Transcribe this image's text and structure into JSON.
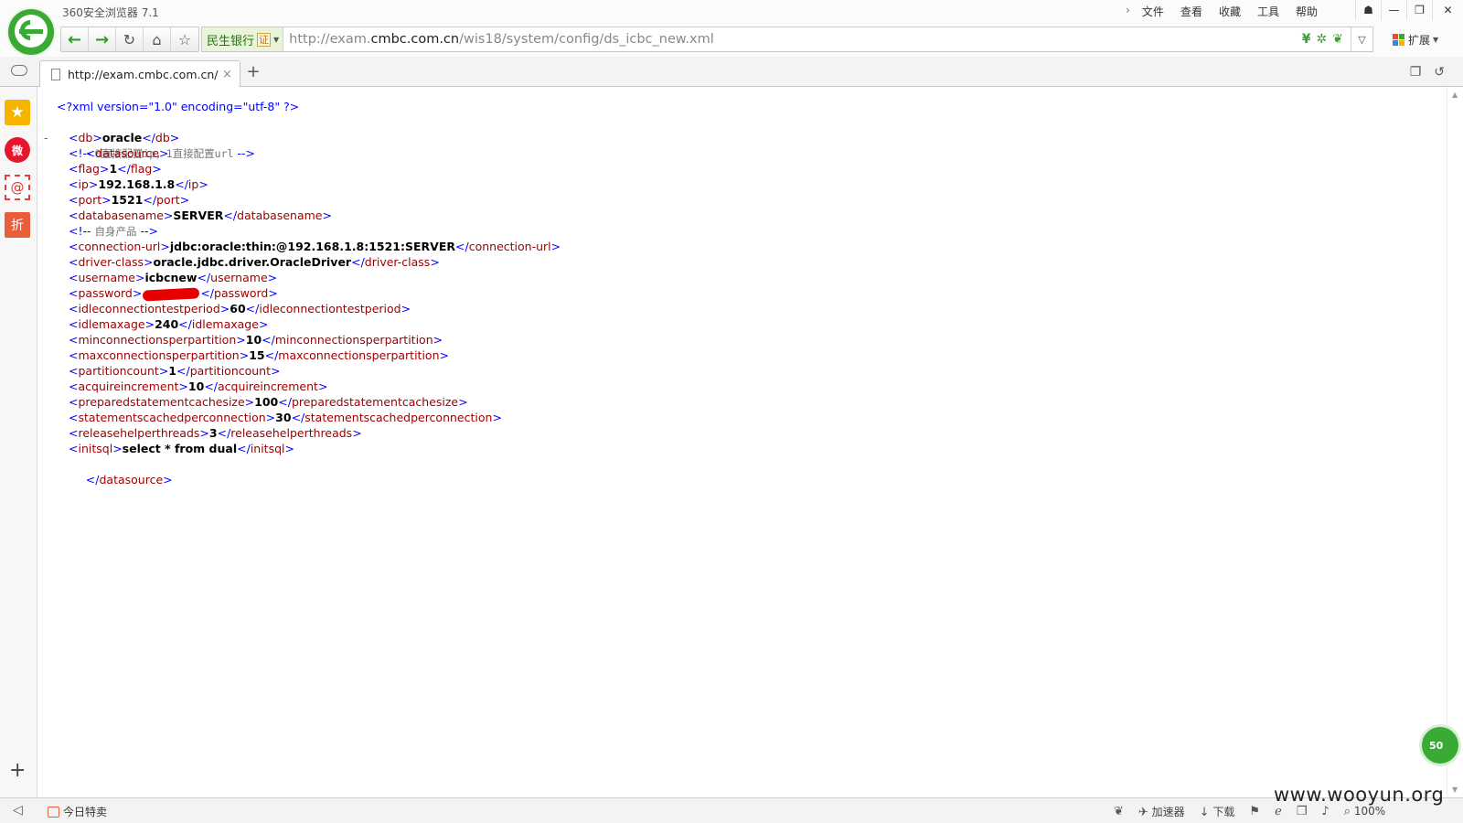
{
  "app": {
    "title": "360安全浏览器 7.1",
    "menu": [
      "文件",
      "查看",
      "收藏",
      "工具",
      "帮助"
    ],
    "window_controls": {
      "skin": "☗",
      "minimize": "—",
      "restore": "❐",
      "close": "✕"
    }
  },
  "navbar": {
    "site_name": "民生银行",
    "cert_label": "证",
    "url_prefix": "http://exam.",
    "url_domain": "cmbc.com.cn",
    "url_path": "/wis18/system/config/ds_icbc_new.xml",
    "extensions_label": "扩展"
  },
  "tab": {
    "title": "http://exam.cmbc.com.cn/wis18/system/config/ds_icbc_new.xml",
    "close": "×",
    "new_tab": "+"
  },
  "xml": {
    "declaration": "<?xml version=\"1.0\" encoding=\"utf-8\" ?>",
    "toggle": "-",
    "root": "datasource",
    "comment1": "0直接配置ip，1直接配置url",
    "comment2": "自身产品",
    "elements": [
      {
        "tag": "db",
        "value": "oracle"
      },
      {
        "tag": "flag",
        "value": "1"
      },
      {
        "tag": "ip",
        "value": "192.168.1.8"
      },
      {
        "tag": "port",
        "value": "1521"
      },
      {
        "tag": "databasename",
        "value": "SERVER"
      },
      {
        "tag": "connection-url",
        "value": "jdbc:oracle:thin:@192.168.1.8:1521:SERVER"
      },
      {
        "tag": "driver-class",
        "value": "oracle.jdbc.driver.OracleDriver"
      },
      {
        "tag": "username",
        "value": "icbcnew"
      },
      {
        "tag": "password",
        "value": ""
      },
      {
        "tag": "idleconnectiontestperiod",
        "value": "60"
      },
      {
        "tag": "idlemaxage",
        "value": "240"
      },
      {
        "tag": "minconnectionsperpartition",
        "value": "10"
      },
      {
        "tag": "maxconnectionsperpartition",
        "value": "15"
      },
      {
        "tag": "partitioncount",
        "value": "1"
      },
      {
        "tag": "acquireincrement",
        "value": "10"
      },
      {
        "tag": "preparedstatementcachesize",
        "value": "100"
      },
      {
        "tag": "statementscachedperconnection",
        "value": "30"
      },
      {
        "tag": "releasehelperthreads",
        "value": "3"
      },
      {
        "tag": "initsql",
        "value": "select * from dual"
      }
    ]
  },
  "sidebar": {
    "weibo_label": "微",
    "mail_label": "@",
    "shop_label": "折",
    "add_label": "+"
  },
  "statusbar": {
    "deal_label": "今日特卖",
    "accelerator_label": "加速器",
    "download_label": "下载",
    "zoom": "100%",
    "speed_badge": "50"
  },
  "watermark": "www.wooyun.org",
  "colors": {
    "brand_green": "#3aaa35",
    "xml_tag": "#990000",
    "xml_bracket": "#0000ff",
    "redaction": "#e80000"
  }
}
